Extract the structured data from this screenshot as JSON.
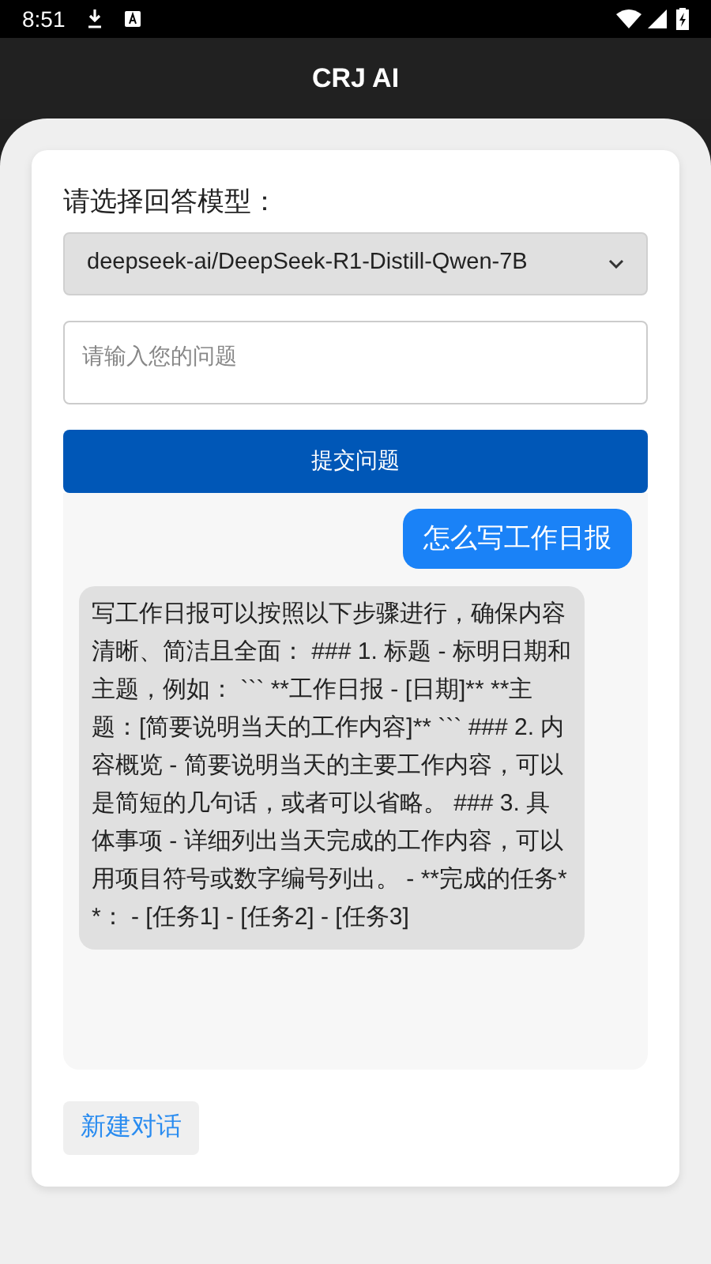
{
  "status_bar": {
    "time": "8:51"
  },
  "app_bar": {
    "title": "CRJ AI"
  },
  "form": {
    "model_label": "请选择回答模型：",
    "model_select": {
      "value": "deepseek-ai/DeepSeek-R1-Distill-Qwen-7B"
    },
    "question_field": {
      "placeholder": "请输入您的问题"
    },
    "submit_button": "提交问题"
  },
  "messages": [
    {
      "kind": "user",
      "text": "怎么写工作日报"
    },
    {
      "kind": "assistant",
      "text": "写工作日报可以按照以下步骤进行，确保内容清晰、简洁且全面： ### 1. 标题 - 标明日期和主题，例如： ``` **工作日报 - [日期]** **主题：[简要说明当天的工作内容]** ``` ### 2. 内容概览 - 简要说明当天的主要工作内容，可以是简短的几句话，或者可以省略。 ### 3. 具体事项 - 详细列出当天完成的工作内容，可以用项目符号或数字编号列出。 - **完成的任务**： - [任务1] - [任务2] - [任务3]"
    }
  ],
  "new_chat_button": "新建对话"
}
